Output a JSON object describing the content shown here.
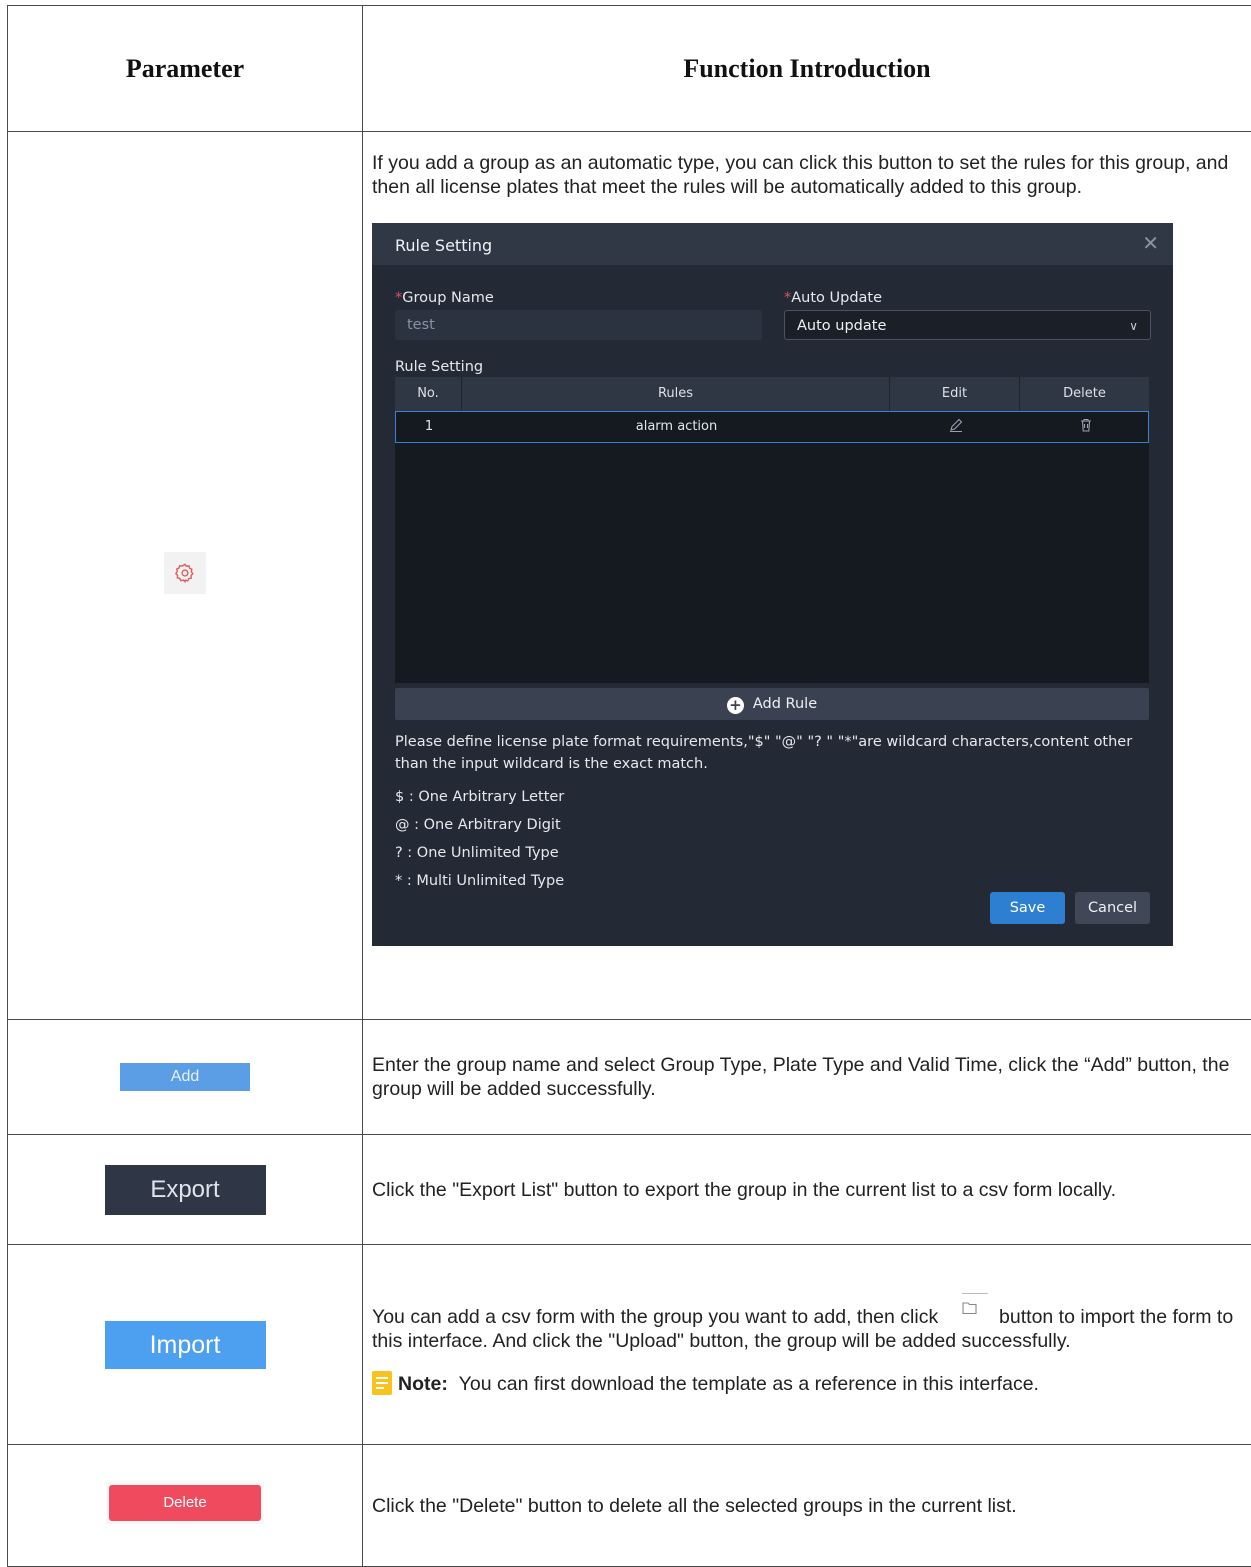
{
  "headers": {
    "param": "Parameter",
    "func": "Function Introduction"
  },
  "rows": {
    "rule": {
      "icon": "gear-icon",
      "desc": "If you add a group as an automatic type, you can click this button to set the rules for this group, and then all license plates that meet the rules will be automatically added to this group."
    },
    "add": {
      "button": "Add",
      "desc": "Enter the group name and select Group Type, Plate Type and Valid Time, click the “Add” button, the group will be added successfully."
    },
    "export": {
      "button": "Export",
      "desc": "Click the \"Export List\" button to export the group in the current list to a csv form locally."
    },
    "import": {
      "button": "Import",
      "desc_before": "You can add a csv form with the group you want to add, then click",
      "folder_icon": "folder-icon",
      "desc_after": "button to import the form to this interface. And click the \"Upload\" button, the group will be added successfully.",
      "note_label": "Note:",
      "note_text": "You can first download the template as a reference in this interface."
    },
    "delete": {
      "button": "Delete",
      "desc": "Click the \"Delete\" button to delete all the selected groups in the current list."
    }
  },
  "dialog": {
    "title": "Rule Setting",
    "close": "✕",
    "group_name_label": "Group Name",
    "group_name_value": "test",
    "auto_update_label": "Auto Update",
    "auto_update_value": "Auto update",
    "required_mark": "*",
    "section_label": "Rule Setting",
    "columns": {
      "no": "No.",
      "rules": "Rules",
      "edit": "Edit",
      "delete": "Delete"
    },
    "row": {
      "no": "1",
      "rule": "alarm action"
    },
    "add_rule": "Add Rule",
    "hint": "Please define license plate format requirements,\"$\"  \"@\"  \"? \"  \"*\"are wildcard characters,content other than the input wildcard is the exact match.",
    "legend": [
      "$ : One Arbitrary Letter",
      "@ : One Arbitrary Digit",
      "? : One Unlimited Type",
      "* : Multi Unlimited Type"
    ],
    "save": "Save",
    "cancel": "Cancel"
  },
  "colors": {
    "dialog_bg": "#232a36",
    "primary": "#2d7fd1",
    "danger": "#ef4a5e",
    "note": "#f8c21f"
  }
}
